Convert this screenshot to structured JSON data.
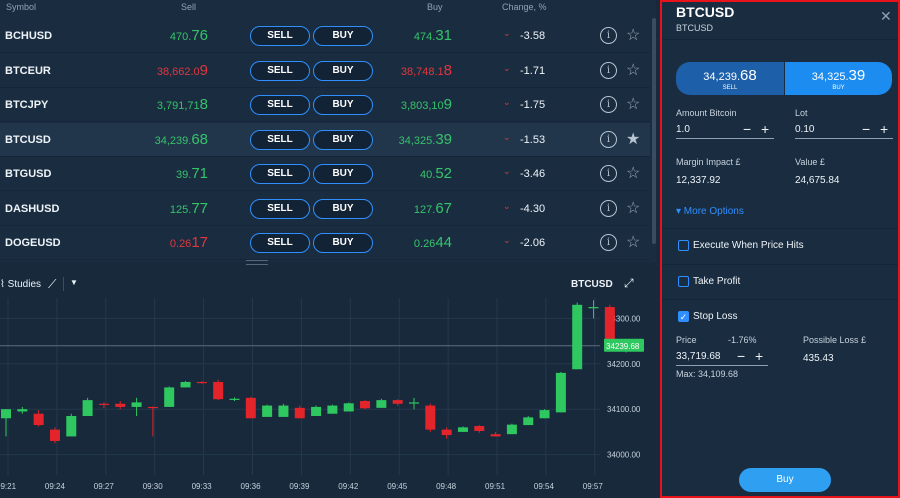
{
  "watchlist": {
    "headers": {
      "symbol": "Symbol",
      "sell": "Sell",
      "buy": "Buy",
      "change": "Change, %"
    },
    "rows": [
      {
        "symbol": "BCHUSD",
        "sell_small": "470.",
        "sell_big": "76",
        "sell_color": "green",
        "buy_small": "474.",
        "buy_big": "31",
        "buy_color": "green",
        "change": "-3.58",
        "starred": false
      },
      {
        "symbol": "BTCEUR",
        "sell_small": "38,662.0",
        "sell_big": "9",
        "sell_color": "red",
        "buy_small": "38,748.1",
        "buy_big": "8",
        "buy_color": "red",
        "change": "-1.71",
        "starred": false
      },
      {
        "symbol": "BTCJPY",
        "sell_small": "3,791,71",
        "sell_big": "8",
        "sell_color": "green",
        "buy_small": "3,803,10",
        "buy_big": "9",
        "buy_color": "green",
        "change": "-1.75",
        "starred": false
      },
      {
        "symbol": "BTCUSD",
        "sell_small": "34,239.",
        "sell_big": "68",
        "sell_color": "green",
        "buy_small": "34,325.",
        "buy_big": "39",
        "buy_color": "green",
        "change": "-1.53",
        "starred": true
      },
      {
        "symbol": "BTGUSD",
        "sell_small": "39.",
        "sell_big": "71",
        "sell_color": "green",
        "buy_small": "40.",
        "buy_big": "52",
        "buy_color": "green",
        "change": "-3.46",
        "starred": false
      },
      {
        "symbol": "DASHUSD",
        "sell_small": "125.",
        "sell_big": "77",
        "sell_color": "green",
        "buy_small": "127.",
        "buy_big": "67",
        "buy_color": "green",
        "change": "-4.30",
        "starred": false
      },
      {
        "symbol": "DOGEUSD",
        "sell_small": "0.26",
        "sell_big": "17",
        "sell_color": "red",
        "buy_small": "0.26",
        "buy_big": "44",
        "buy_color": "green",
        "change": "-2.06",
        "starred": false
      }
    ],
    "sell_label": "SELL",
    "buy_label": "BUY",
    "info_glyph": "i",
    "star_glyph": "☆",
    "star_filled_glyph": "★",
    "down_arrow": "⌄"
  },
  "chart": {
    "studies_label": "Studies",
    "symbol": "BTCUSD",
    "current_price_label": "34239.68",
    "colors": {
      "up": "#2fc760",
      "down": "#e3242b",
      "grid": "#25394d",
      "label_bg": "#2fc760"
    }
  },
  "chart_data": {
    "type": "candlestick",
    "x_ticks": [
      "09:21",
      "09:24",
      "09:27",
      "09:30",
      "09:33",
      "09:36",
      "09:39",
      "09:42",
      "09:45",
      "09:48",
      "09:51",
      "09:54",
      "09:57"
    ],
    "y_ticks": [
      34000.0,
      34100.0,
      34200.0,
      34300.0
    ],
    "y_tick_labels": [
      "34000.00",
      "34100.00",
      "34200.00",
      "34300.00"
    ],
    "ylim": [
      33955,
      34345
    ],
    "current_price": 34239.68,
    "candles": [
      {
        "o": 34080,
        "h": 34100,
        "l": 34040,
        "c": 34100
      },
      {
        "o": 34095,
        "h": 34105,
        "l": 34090,
        "c": 34100
      },
      {
        "o": 34090,
        "h": 34098,
        "l": 34062,
        "c": 34065
      },
      {
        "o": 34055,
        "h": 34060,
        "l": 34025,
        "c": 34030
      },
      {
        "o": 34040,
        "h": 34090,
        "l": 34040,
        "c": 34085
      },
      {
        "o": 34085,
        "h": 34125,
        "l": 34085,
        "c": 34120
      },
      {
        "o": 34112,
        "h": 34115,
        "l": 34102,
        "c": 34110
      },
      {
        "o": 34112,
        "h": 34118,
        "l": 34100,
        "c": 34105
      },
      {
        "o": 34105,
        "h": 34125,
        "l": 34085,
        "c": 34115
      },
      {
        "o": 34105,
        "h": 34106,
        "l": 34040,
        "c": 34103
      },
      {
        "o": 34105,
        "h": 34150,
        "l": 34105,
        "c": 34148
      },
      {
        "o": 34148,
        "h": 34162,
        "l": 34148,
        "c": 34160
      },
      {
        "o": 34160,
        "h": 34162,
        "l": 34156,
        "c": 34158
      },
      {
        "o": 34160,
        "h": 34165,
        "l": 34120,
        "c": 34122
      },
      {
        "o": 34122,
        "h": 34126,
        "l": 34118,
        "c": 34123
      },
      {
        "o": 34125,
        "h": 34127,
        "l": 34080,
        "c": 34080
      },
      {
        "o": 34083,
        "h": 34110,
        "l": 34083,
        "c": 34108
      },
      {
        "o": 34083,
        "h": 34112,
        "l": 34083,
        "c": 34108
      },
      {
        "o": 34103,
        "h": 34108,
        "l": 34080,
        "c": 34080
      },
      {
        "o": 34085,
        "h": 34108,
        "l": 34085,
        "c": 34105
      },
      {
        "o": 34090,
        "h": 34110,
        "l": 34090,
        "c": 34108
      },
      {
        "o": 34095,
        "h": 34115,
        "l": 34095,
        "c": 34113
      },
      {
        "o": 34118,
        "h": 34120,
        "l": 34100,
        "c": 34102
      },
      {
        "o": 34103,
        "h": 34123,
        "l": 34103,
        "c": 34120
      },
      {
        "o": 34120,
        "h": 34122,
        "l": 34108,
        "c": 34112
      },
      {
        "o": 34115,
        "h": 34125,
        "l": 34100,
        "c": 34115
      },
      {
        "o": 34108,
        "h": 34112,
        "l": 34050,
        "c": 34055
      },
      {
        "o": 34055,
        "h": 34060,
        "l": 34035,
        "c": 34043
      },
      {
        "o": 34050,
        "h": 34062,
        "l": 34050,
        "c": 34060
      },
      {
        "o": 34063,
        "h": 34065,
        "l": 34048,
        "c": 34052
      },
      {
        "o": 34045,
        "h": 34050,
        "l": 34040,
        "c": 34040
      },
      {
        "o": 34045,
        "h": 34068,
        "l": 34045,
        "c": 34066
      },
      {
        "o": 34065,
        "h": 34085,
        "l": 34065,
        "c": 34082
      },
      {
        "o": 34080,
        "h": 34100,
        "l": 34080,
        "c": 34098
      },
      {
        "o": 34093,
        "h": 34182,
        "l": 34093,
        "c": 34180
      },
      {
        "o": 34188,
        "h": 34335,
        "l": 34188,
        "c": 34330
      },
      {
        "o": 34325,
        "h": 34340,
        "l": 34300,
        "c": 34325
      },
      {
        "o": 34325,
        "h": 34330,
        "l": 34237,
        "c": 34240
      },
      {
        "o": 34236,
        "h": 34240,
        "l": 34225,
        "c": 34237
      }
    ]
  },
  "panel": {
    "title": "BTCUSD",
    "subtitle": "BTCUSD",
    "close_glyph": "✕",
    "sell_small": "34,239.",
    "sell_big": "68",
    "sell_label": "SELL",
    "buy_small": "34,325.",
    "buy_big": "39",
    "buy_label": "BUY",
    "amount_label": "Amount Bitcoin",
    "amount_value": "1.0",
    "lot_label": "Lot",
    "lot_value": "0.10",
    "margin_label": "Margin Impact £",
    "margin_value": "12,337.92",
    "value_label": "Value £",
    "value_value": "24,675.84",
    "more_options": "▾ More Options",
    "execute_label": "Execute When Price Hits",
    "take_profit_label": "Take Profit",
    "stop_loss_label": "Stop Loss",
    "price_label": "Price",
    "price_pct": "-1.76%",
    "price_value": "33,719.68",
    "price_max": "Max: 34,109.68",
    "possible_loss_label": "Possible Loss £",
    "possible_loss_value": "435.43",
    "buy_button": "Buy",
    "minus": "−",
    "plus": "+"
  }
}
